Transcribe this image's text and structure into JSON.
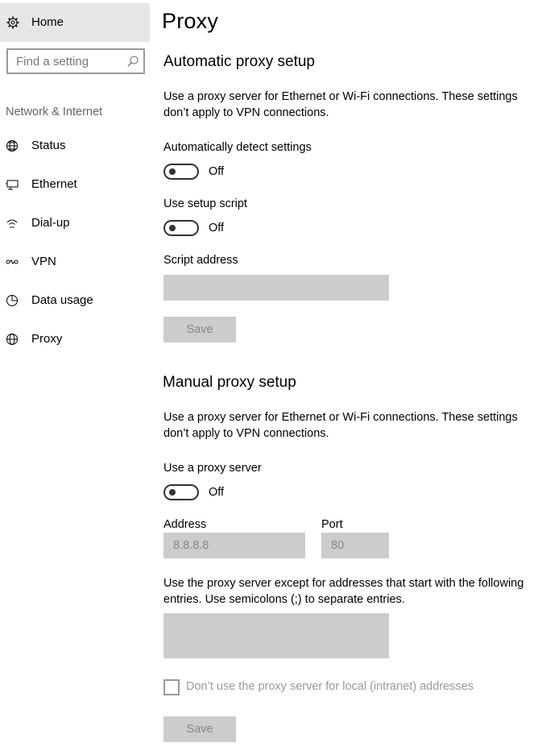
{
  "sidebar": {
    "home_label": "Home",
    "search": {
      "placeholder": "Find a setting"
    },
    "section_label": "Network & Internet",
    "items": [
      {
        "label": "Status",
        "icon": "globe-status-icon"
      },
      {
        "label": "Ethernet",
        "icon": "ethernet-icon"
      },
      {
        "label": "Dial-up",
        "icon": "dialup-icon"
      },
      {
        "label": "VPN",
        "icon": "vpn-icon"
      },
      {
        "label": "Data usage",
        "icon": "data-usage-icon"
      },
      {
        "label": "Proxy",
        "icon": "globe-icon"
      }
    ]
  },
  "main": {
    "title": "Proxy",
    "automatic": {
      "heading": "Automatic proxy setup",
      "description": "Use a proxy server for Ethernet or Wi-Fi connections. These settings don’t apply to VPN connections.",
      "detect_label": "Automatically detect settings",
      "detect_state": "Off",
      "script_label": "Use setup script",
      "script_state": "Off",
      "script_address_label": "Script address",
      "script_address_value": "",
      "save_label": "Save"
    },
    "manual": {
      "heading": "Manual proxy setup",
      "description": "Use a proxy server for Ethernet or Wi-Fi connections. These settings don’t apply to VPN connections.",
      "use_proxy_label": "Use a proxy server",
      "use_proxy_state": "Off",
      "address_label": "Address",
      "address_value": "8.8.8.8",
      "port_label": "Port",
      "port_value": "80",
      "exceptions_description": "Use the proxy server except for addresses that start with the following entries. Use semicolons (;) to separate entries.",
      "exceptions_value": "",
      "local_checkbox_label": "Don’t use the proxy server for local (intranet) addresses",
      "local_checked": false,
      "save_label": "Save"
    }
  },
  "colors": {
    "home_bg": "#e6e6e6",
    "disabled_field": "#cccccc",
    "disabled_text": "#888888",
    "section_text": "#666666"
  }
}
